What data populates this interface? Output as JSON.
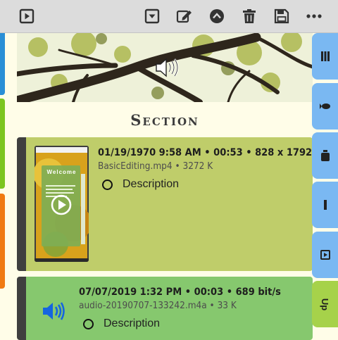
{
  "section": {
    "title": "Section"
  },
  "items": [
    {
      "meta": "01/19/1970  9:58 AM • 00:53 • 828 x 1792",
      "filename": "BasicEditing.mp4 • 3272 K",
      "description": "Description",
      "thumbnail_caption": "Welcome"
    },
    {
      "meta": "07/07/2019  1:32 PM • 00:03 • 689 bit/s",
      "filename": "audio-20190707-133242.m4a • 33 K",
      "description": "Description"
    }
  ],
  "right_tabs": {
    "up_label": "Up"
  },
  "icons": {
    "toolbar": [
      "play-box-icon",
      "dropdown-box-icon",
      "edit-icon",
      "arrow-up-circle-icon",
      "trash-icon",
      "save-icon",
      "more-icon"
    ],
    "banner": "speaker-icon"
  },
  "colors": {
    "toolbar": "#dcdcdc",
    "card_video": "#bfcd6a",
    "card_audio": "#86c86e",
    "side_tab_blue": "#7ab8f2",
    "side_tab_lime": "#a6d24a",
    "audio_icon": "#1565e0"
  }
}
